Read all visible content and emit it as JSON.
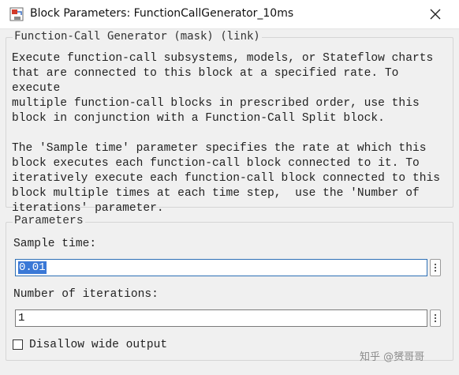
{
  "window": {
    "title": "Block Parameters: FunctionCallGenerator_10ms",
    "icons": {
      "app": "simulink-block-icon",
      "close": "close-icon"
    }
  },
  "mask": {
    "header": "Function-Call Generator (mask) (link)",
    "description": "Execute function-call subsystems, models, or Stateflow charts\nthat are connected to this block at a specified rate. To execute\nmultiple function-call blocks in prescribed order, use this\nblock in conjunction with a Function-Call Split block.\n\nThe 'Sample time' parameter specifies the rate at which this\nblock executes each function-call block connected to it. To\niteratively execute each function-call block connected to this\nblock multiple times at each time step,  use the 'Number of\niterations' parameter."
  },
  "parameters": {
    "header": "Parameters",
    "sample_time": {
      "label": "Sample time:",
      "value": "0.01"
    },
    "iterations": {
      "label": "Number of iterations:",
      "value": "1"
    },
    "disallow_wide": {
      "label": "Disallow wide output",
      "checked": false
    }
  },
  "watermark": "知乎 @赟哥哥",
  "colors": {
    "selection": "#3a78d6",
    "focus_border": "#2d6fb5",
    "background": "#f0f0f0"
  }
}
